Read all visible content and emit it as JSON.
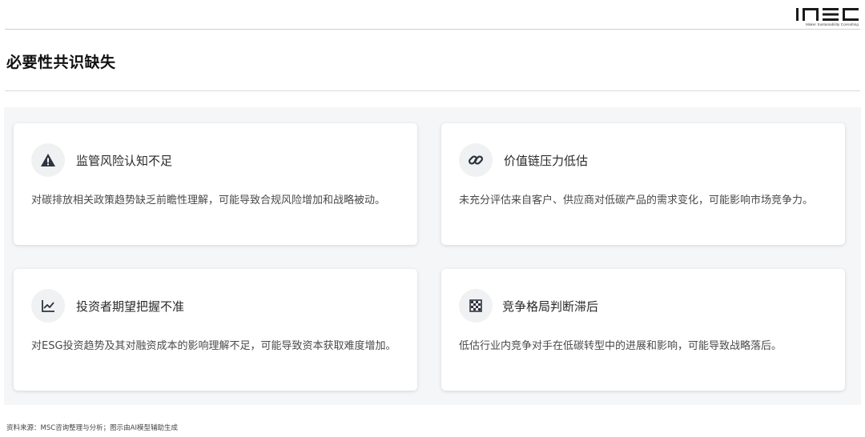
{
  "header": {
    "logo_text": "MSC",
    "logo_subtitle": "Maker Sustainability Consulting"
  },
  "page": {
    "title": "必要性共识缺失"
  },
  "cards": [
    {
      "icon": "warning-triangle-icon",
      "title": "监管风险认知不足",
      "description": "对碳排放相关政策趋势缺乏前瞻性理解，可能导致合规风险增加和战略被动。"
    },
    {
      "icon": "link-icon",
      "title": "价值链压力低估",
      "description": "未充分评估来自客户、供应商对低碳产品的需求变化，可能影响市场竞争力。"
    },
    {
      "icon": "line-chart-icon",
      "title": "投资者期望把握不准",
      "description": "对ESG投资趋势及其对融资成本的影响理解不足，可能导致资本获取难度增加。"
    },
    {
      "icon": "chessboard-icon",
      "title": "竞争格局判断滞后",
      "description": "低估行业内竞争对手在低碳转型中的进展和影响，可能导致战略落后。"
    }
  ],
  "footer": {
    "source": "资料来源：MSC咨询整理与分析；图示由AI模型辅助生成"
  },
  "colors": {
    "panel_background": "#f5f6f8",
    "icon_background": "#f0f1f3",
    "icon_color": "#2d3340"
  }
}
